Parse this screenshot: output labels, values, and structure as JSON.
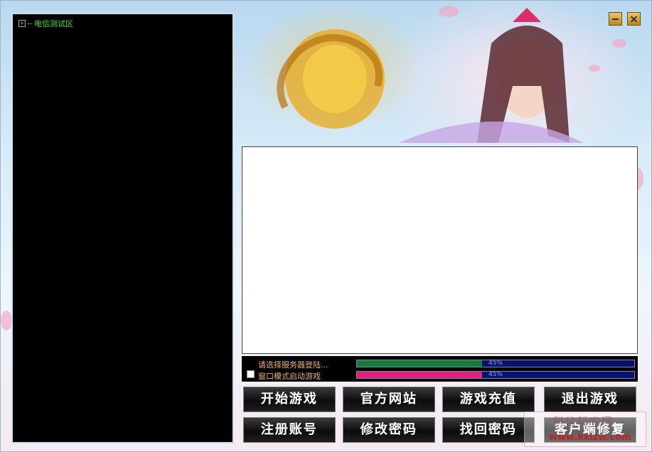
{
  "server_list": {
    "nodes": [
      {
        "label": "电信测试区"
      }
    ]
  },
  "window_controls": {
    "minimize_icon": "minimize-icon",
    "close_icon": "close-icon"
  },
  "status": {
    "server_prompt": "请选择服务器登陆...",
    "window_mode_label": "窗口模式启动游戏",
    "window_mode_checked": false,
    "progress": [
      {
        "value": 45,
        "text": "45%",
        "color": "#1a7a3c"
      },
      {
        "value": 45,
        "text": "45%",
        "color": "#e0207a"
      }
    ]
  },
  "buttons": {
    "start_game": "开始游戏",
    "official_site": "官方网站",
    "recharge": "游戏充值",
    "exit_game": "退出游戏",
    "register": "注册账号",
    "change_password": "修改密码",
    "recover_password": "找回密码",
    "client_repair": "客户端修复"
  },
  "watermark": {
    "site_cn": "科信耘农理",
    "url": "www.kxlzw.com"
  },
  "colors": {
    "server_text": "#37e237",
    "status_text": "#f0b070"
  }
}
